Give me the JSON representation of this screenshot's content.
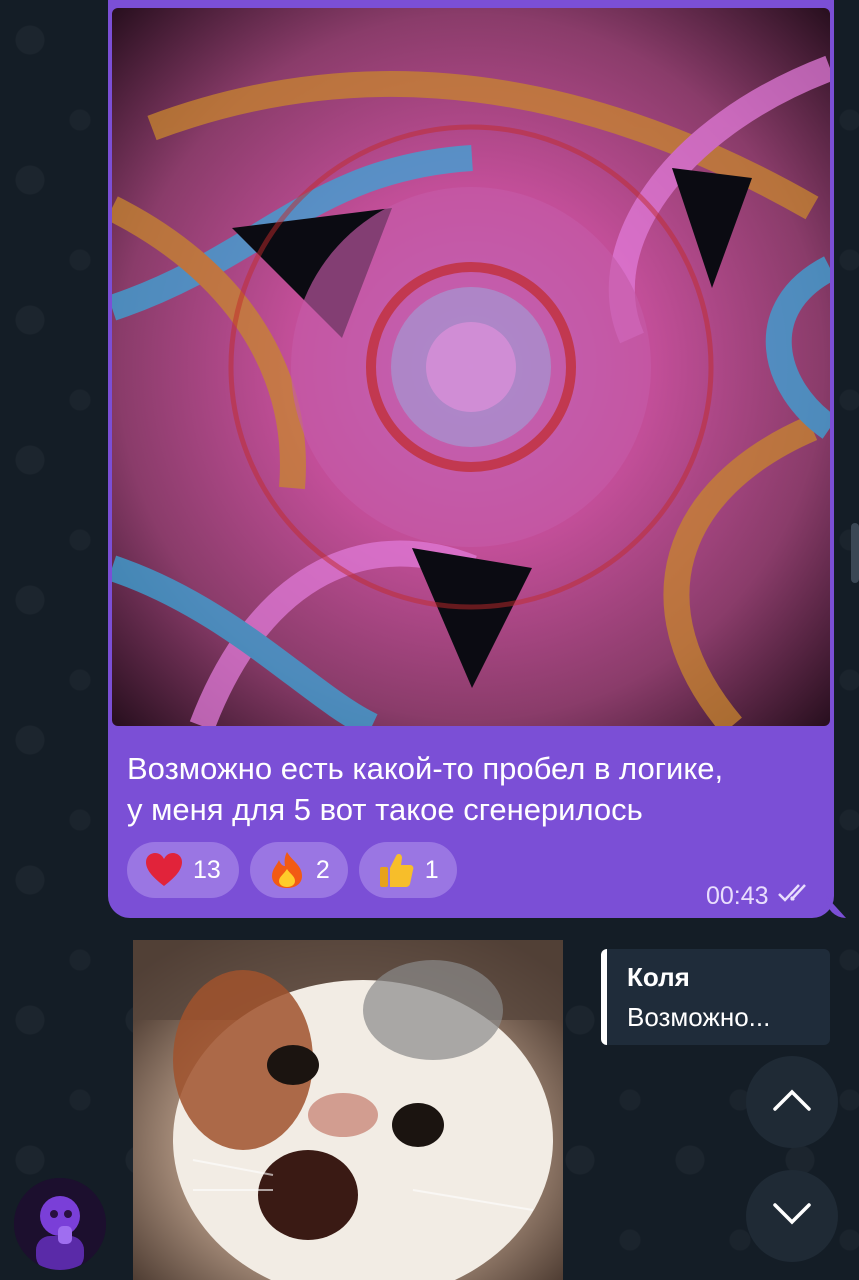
{
  "message": {
    "caption_lines": [
      "Возможно есть какой-то пробел в логике,",
      "у меня для 5 вот такое сгенерилось"
    ],
    "time": "00:43",
    "status_icon": "double-check-icon",
    "reactions": [
      {
        "emoji": "heart-icon",
        "count": "13"
      },
      {
        "emoji": "fire-icon",
        "count": "2"
      },
      {
        "emoji": "thumbs-up-icon",
        "count": "1"
      }
    ]
  },
  "reply": {
    "name": "Коля",
    "text": "Возможно..."
  },
  "colors": {
    "outgoing_bubble": "#7b4fd6",
    "reaction_chip": "#9a76e3",
    "background": "#141d26"
  }
}
